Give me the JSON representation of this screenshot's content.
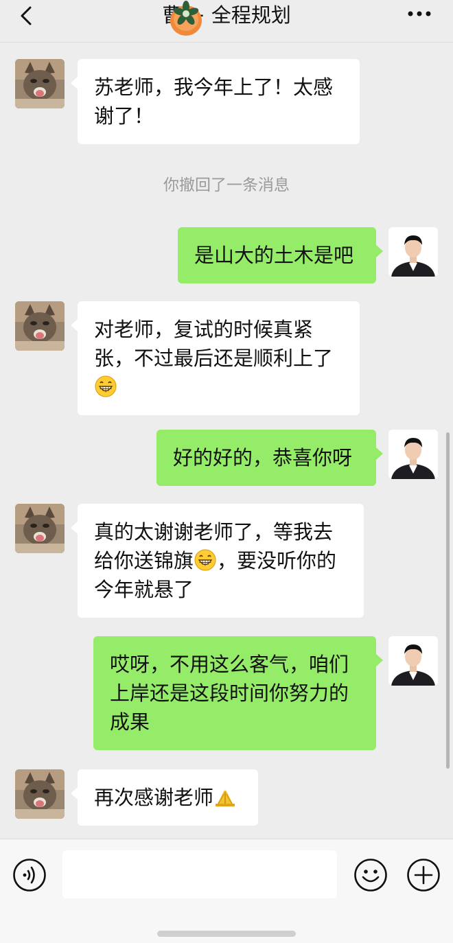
{
  "header": {
    "title": "曹  + 全程规划",
    "back_icon": "chevron-left-icon",
    "more_icon": "ellipsis-icon"
  },
  "messages": [
    {
      "side": "in",
      "avatar": "cat-avatar",
      "text": "苏老师，我今年上了！太感谢了！"
    },
    {
      "side": "out",
      "avatar": "person-avatar",
      "text": "是山大的土木是吧"
    },
    {
      "side": "in",
      "avatar": "cat-avatar",
      "text_before": "对老师，复试的时候真紧张，不过最后还是顺利上了",
      "emoji": "grin-emoji"
    },
    {
      "side": "out",
      "avatar": "person-avatar",
      "text": "好的好的，恭喜你呀"
    },
    {
      "side": "in",
      "avatar": "cat-avatar",
      "text_before": "真的太谢谢老师了，等我去给你送锦旗",
      "emoji": "grin-emoji",
      "text_after": "，要没听你的今年就悬了"
    },
    {
      "side": "out",
      "avatar": "person-avatar",
      "text": "哎呀，不用这么客气，咱们上岸还是这段时间你努力的成果"
    },
    {
      "side": "in",
      "avatar": "cat-avatar",
      "text_before": "再次感谢老师",
      "emoji": "pray-hands-emoji"
    }
  ],
  "system_note": "你撤回了一条消息",
  "input_bar": {
    "voice_icon": "voice-icon",
    "emoji_icon": "smiley-icon",
    "plus_icon": "plus-circle-icon",
    "placeholder": ""
  },
  "colors": {
    "background": "#ededed",
    "outgoing_bubble": "#95ec69",
    "incoming_bubble": "#ffffff"
  }
}
